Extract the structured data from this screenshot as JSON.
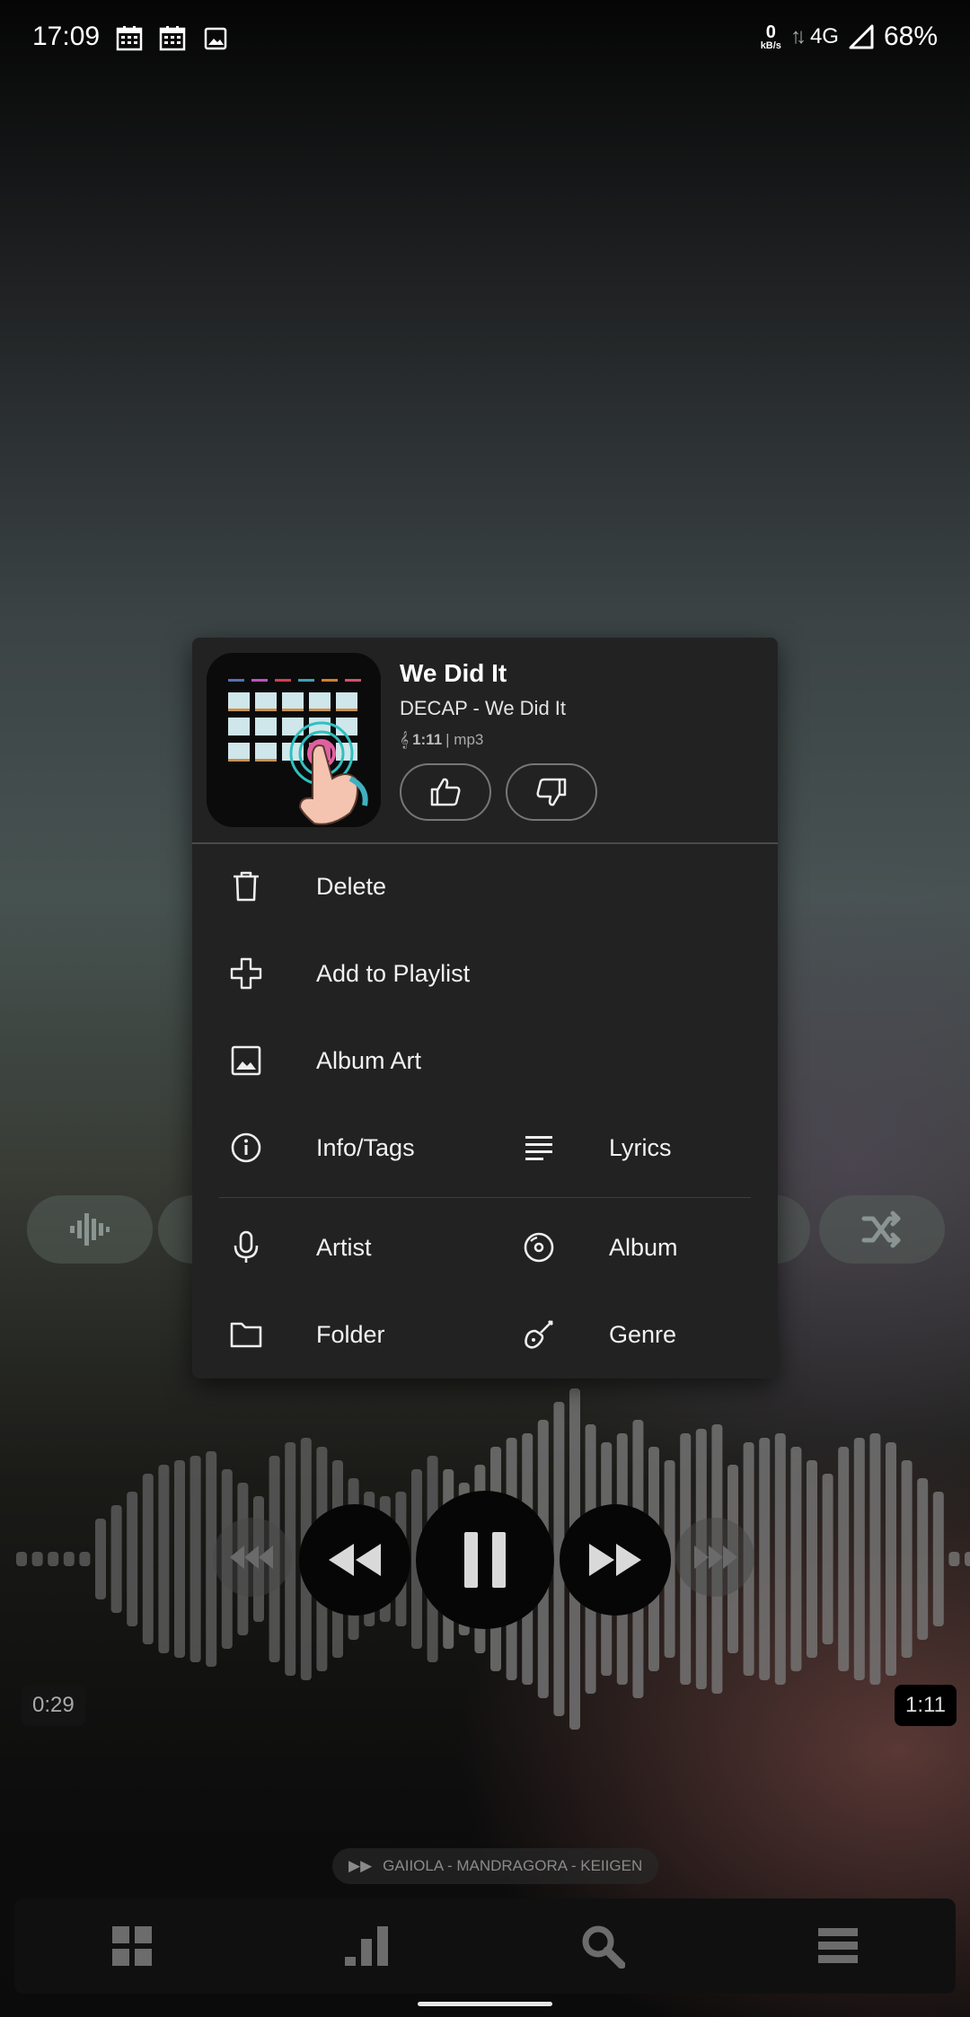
{
  "status_bar": {
    "time": "17:09",
    "net_speed_value": "0",
    "net_speed_unit": "kB/s",
    "network": "4G",
    "battery": "68%",
    "icons": [
      "calendar-icon",
      "calendar-icon",
      "image-icon",
      "data-arrows-icon",
      "signal-icon"
    ]
  },
  "song": {
    "title": "We Did It",
    "subtitle": "DECAP - We Did It",
    "duration": "1:11",
    "format": "| mp3"
  },
  "menu": {
    "delete": "Delete",
    "add_to_playlist": "Add to Playlist",
    "album_art": "Album Art",
    "info_tags": "Info/Tags",
    "lyrics": "Lyrics",
    "artist": "Artist",
    "album": "Album",
    "folder": "Folder",
    "genre": "Genre"
  },
  "player": {
    "elapsed": "0:29",
    "total": "1:11",
    "queue_next": "GAIIOLA - MANDRAGORA - KEIIGEN"
  },
  "bottom_nav": [
    "grid-icon",
    "chart-icon",
    "search-icon",
    "menu-icon"
  ],
  "colors": {
    "menu_bg": "#222222",
    "control_bg": "#060606"
  }
}
